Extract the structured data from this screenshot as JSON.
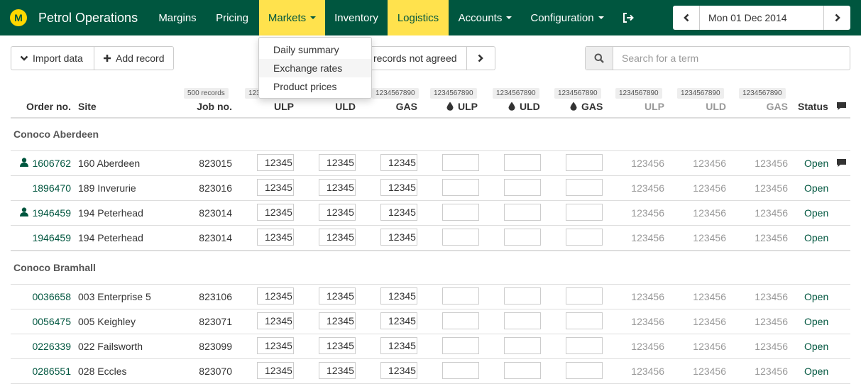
{
  "app": {
    "logo_letter": "M",
    "title": "Petrol Operations"
  },
  "nav": {
    "items": [
      {
        "label": "Margins"
      },
      {
        "label": "Pricing"
      },
      {
        "label": "Markets"
      },
      {
        "label": "Inventory"
      },
      {
        "label": "Logistics"
      },
      {
        "label": "Accounts"
      },
      {
        "label": "Configuration"
      }
    ],
    "logout_icon": "sign-out-icon"
  },
  "date_picker": {
    "value": "Mon 01 Dec 2014",
    "prev_icon": "chevron-left-icon",
    "next_icon": "chevron-right-icon"
  },
  "toolbar": {
    "import_label": "Import data",
    "add_label": "Add record",
    "filter_label": "records not agreed",
    "search_placeholder": "Search for a term"
  },
  "markets_menu": {
    "items": [
      {
        "label": "Daily summary"
      },
      {
        "label": "Exchange rates"
      },
      {
        "label": "Product prices"
      }
    ],
    "active_index": 1
  },
  "table": {
    "count_badges": {
      "job": "500 records",
      "ulp": "1234567890",
      "gas": "1234567890",
      "dulp": "1234567890",
      "duld": "1234567890",
      "dgas": "1234567890",
      "mulp": "1234567890",
      "muld": "1234567890",
      "mgas": "1234567890"
    },
    "headers": {
      "order": "Order no.",
      "site": "Site",
      "job": "Job no.",
      "ulp": "ULP",
      "uld": "ULD",
      "gas": "GAS",
      "dulp": "ULP",
      "duld": "ULD",
      "dgas": "GAS",
      "mulp": "ULP",
      "muld": "ULD",
      "mgas": "GAS",
      "status": "Status"
    },
    "groups": [
      {
        "name": "Conoco Aberdeen",
        "rows": [
          {
            "order": "1606762",
            "user": true,
            "site": "160 Aberdeen",
            "job": "823015",
            "ulp": "12345",
            "uld": "12345",
            "gas": "12345",
            "mulp": "123456",
            "muld": "123456",
            "mgas": "123456",
            "status": "Open",
            "comment": true
          },
          {
            "order": "1896470",
            "user": false,
            "site": "189 Inverurie",
            "job": "823016",
            "ulp": "12345",
            "uld": "12345",
            "gas": "12345",
            "mulp": "123456",
            "muld": "123456",
            "mgas": "123456",
            "status": "Open",
            "comment": false
          },
          {
            "order": "1946459",
            "user": true,
            "site": "194 Peterhead",
            "job": "823014",
            "ulp": "12345",
            "uld": "12345",
            "gas": "12345",
            "mulp": "123456",
            "muld": "123456",
            "mgas": "123456",
            "status": "Open",
            "comment": false
          },
          {
            "order": "1946459",
            "user": false,
            "site": "194 Peterhead",
            "job": "823014",
            "ulp": "12345",
            "uld": "12345",
            "gas": "12345",
            "mulp": "123456",
            "muld": "123456",
            "mgas": "123456",
            "status": "Open",
            "comment": false
          }
        ]
      },
      {
        "name": "Conoco Bramhall",
        "rows": [
          {
            "order": "0036658",
            "user": false,
            "site": "003 Enterprise 5",
            "job": "823106",
            "ulp": "12345",
            "uld": "12345",
            "gas": "12345",
            "mulp": "123456",
            "muld": "123456",
            "mgas": "123456",
            "status": "Open",
            "comment": false
          },
          {
            "order": "0056475",
            "user": false,
            "site": "005 Keighley",
            "job": "823071",
            "ulp": "12345",
            "uld": "12345",
            "gas": "12345",
            "mulp": "123456",
            "muld": "123456",
            "mgas": "123456",
            "status": "Open",
            "comment": false
          },
          {
            "order": "0226339",
            "user": false,
            "site": "022 Failsworth",
            "job": "823099",
            "ulp": "12345",
            "uld": "12345",
            "gas": "12345",
            "mulp": "123456",
            "muld": "123456",
            "mgas": "123456",
            "status": "Open",
            "comment": false
          },
          {
            "order": "0286551",
            "user": false,
            "site": "028 Eccles",
            "job": "823070",
            "ulp": "12345",
            "uld": "12345",
            "gas": "12345",
            "mulp": "123456",
            "muld": "123456",
            "mgas": "123456",
            "status": "Open",
            "comment": false
          }
        ]
      }
    ]
  },
  "colors": {
    "brand": "#00563f",
    "highlight": "#ffe24d",
    "logo": "#ffd700"
  }
}
